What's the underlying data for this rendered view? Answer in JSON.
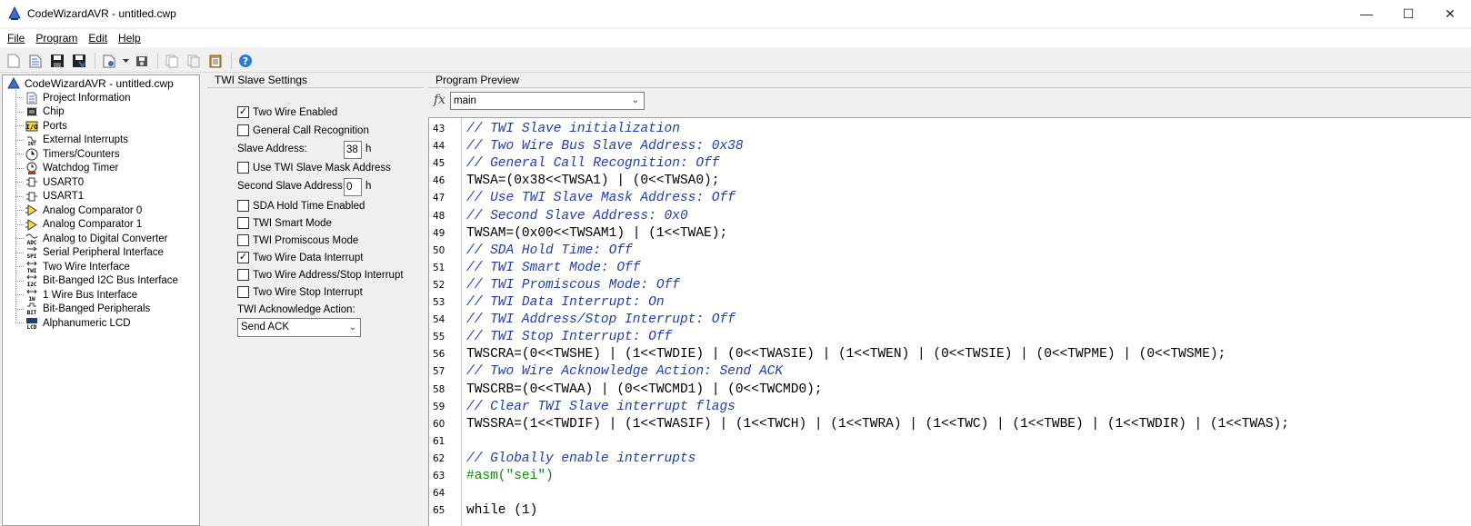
{
  "window": {
    "title": "CodeWizardAVR - untitled.cwp",
    "minimize": "—",
    "maximize": "☐",
    "close": "✕"
  },
  "menu": [
    "File",
    "Program",
    "Edit",
    "Help"
  ],
  "toolbar": {
    "icons": [
      "new-icon",
      "open-icon",
      "save-icon",
      "save-all-icon",
      "generate-icon",
      "dropdown-arrow-icon",
      "generate-save-icon",
      "copy-icon",
      "copy-all-icon",
      "clipboard-icon",
      "help-icon"
    ]
  },
  "tree": {
    "root": "CodeWizardAVR - untitled.cwp",
    "items": [
      "Project Information",
      "Chip",
      "Ports",
      "External Interrupts",
      "Timers/Counters",
      "Watchdog Timer",
      "USART0",
      "USART1",
      "Analog Comparator 0",
      "Analog Comparator 1",
      "Analog to Digital Converter",
      "Serial Peripheral Interface",
      "Two Wire Interface",
      "Bit-Banged I2C Bus Interface",
      "1 Wire Bus Interface",
      "Bit-Banged Peripherals",
      "Alphanumeric LCD"
    ]
  },
  "settings": {
    "header": "TWI Slave Settings",
    "two_wire_enabled": "Two Wire Enabled",
    "general_call": "General Call Recognition",
    "slave_address_label": "Slave Address:",
    "slave_address_value": "38",
    "slave_address_unit": "h",
    "use_mask": "Use TWI Slave Mask Address",
    "second_address_label": "Second Slave Address:",
    "second_address_value": "0",
    "second_address_unit": "h",
    "sda_hold": "SDA Hold Time Enabled",
    "smart_mode": "TWI Smart Mode",
    "promiscous": "TWI Promiscous Mode",
    "data_interrupt": "Two Wire Data Interrupt",
    "address_stop_interrupt": "Two Wire Address/Stop Interrupt",
    "stop_interrupt": "Two Wire Stop Interrupt",
    "ack_label": "TWI Acknowledge Action:",
    "ack_value": "Send ACK",
    "checked": {
      "two_wire_enabled": true,
      "general_call": false,
      "use_mask": false,
      "sda_hold": false,
      "smart_mode": false,
      "promiscous": false,
      "data_interrupt": true,
      "address_stop_interrupt": false,
      "stop_interrupt": false
    }
  },
  "preview": {
    "header": "Program Preview",
    "fx": "fx",
    "function": "main",
    "lines": [
      {
        "n": "43",
        "t": "// TWI Slave initialization",
        "k": "comment"
      },
      {
        "n": "44",
        "t": "// Two Wire Bus Slave Address: 0x38",
        "k": "comment"
      },
      {
        "n": "45",
        "t": "// General Call Recognition: Off",
        "k": "comment"
      },
      {
        "n": "46",
        "t": "TWSA=(0x38<<TWSA1) | (0<<TWSA0);",
        "k": "plain"
      },
      {
        "n": "47",
        "t": "// Use TWI Slave Mask Address: Off",
        "k": "comment"
      },
      {
        "n": "48",
        "t": "// Second Slave Address: 0x0",
        "k": "comment"
      },
      {
        "n": "49",
        "t": "TWSAM=(0x00<<TWSAM1) | (1<<TWAE);",
        "k": "plain"
      },
      {
        "n": "50",
        "t": "// SDA Hold Time: Off",
        "k": "comment"
      },
      {
        "n": "51",
        "t": "// TWI Smart Mode: Off",
        "k": "comment"
      },
      {
        "n": "52",
        "t": "// TWI Promiscous Mode: Off",
        "k": "comment"
      },
      {
        "n": "53",
        "t": "// TWI Data Interrupt: On",
        "k": "comment"
      },
      {
        "n": "54",
        "t": "// TWI Address/Stop Interrupt: Off",
        "k": "comment"
      },
      {
        "n": "55",
        "t": "// TWI Stop Interrupt: Off",
        "k": "comment"
      },
      {
        "n": "56",
        "t": "TWSCRA=(0<<TWSHE) | (1<<TWDIE) | (0<<TWASIE) | (1<<TWEN) | (0<<TWSIE) | (0<<TWPME) | (0<<TWSME);",
        "k": "plain"
      },
      {
        "n": "57",
        "t": "// Two Wire Acknowledge Action: Send ACK",
        "k": "comment"
      },
      {
        "n": "58",
        "t": "TWSCRB=(0<<TWAA) | (0<<TWCMD1) | (0<<TWCMD0);",
        "k": "plain"
      },
      {
        "n": "59",
        "t": "// Clear TWI Slave interrupt flags",
        "k": "comment"
      },
      {
        "n": "60",
        "t": "TWSSRA=(1<<TWDIF) | (1<<TWASIF) | (1<<TWCH) | (1<<TWRA) | (1<<TWC) | (1<<TWBE) | (1<<TWDIR) | (1<<TWAS);",
        "k": "plain"
      },
      {
        "n": "61",
        "t": "",
        "k": "plain"
      },
      {
        "n": "62",
        "t": "// Globally enable interrupts",
        "k": "comment"
      },
      {
        "n": "63",
        "t": "#asm(\"sei\")",
        "k": "directive"
      },
      {
        "n": "64",
        "t": "",
        "k": "plain"
      },
      {
        "n": "65",
        "t": "while (1)",
        "k": "plain"
      }
    ]
  },
  "colors": {
    "comment": "#1f3fa8",
    "directive": "#0a8a0a",
    "code": "#000000"
  }
}
